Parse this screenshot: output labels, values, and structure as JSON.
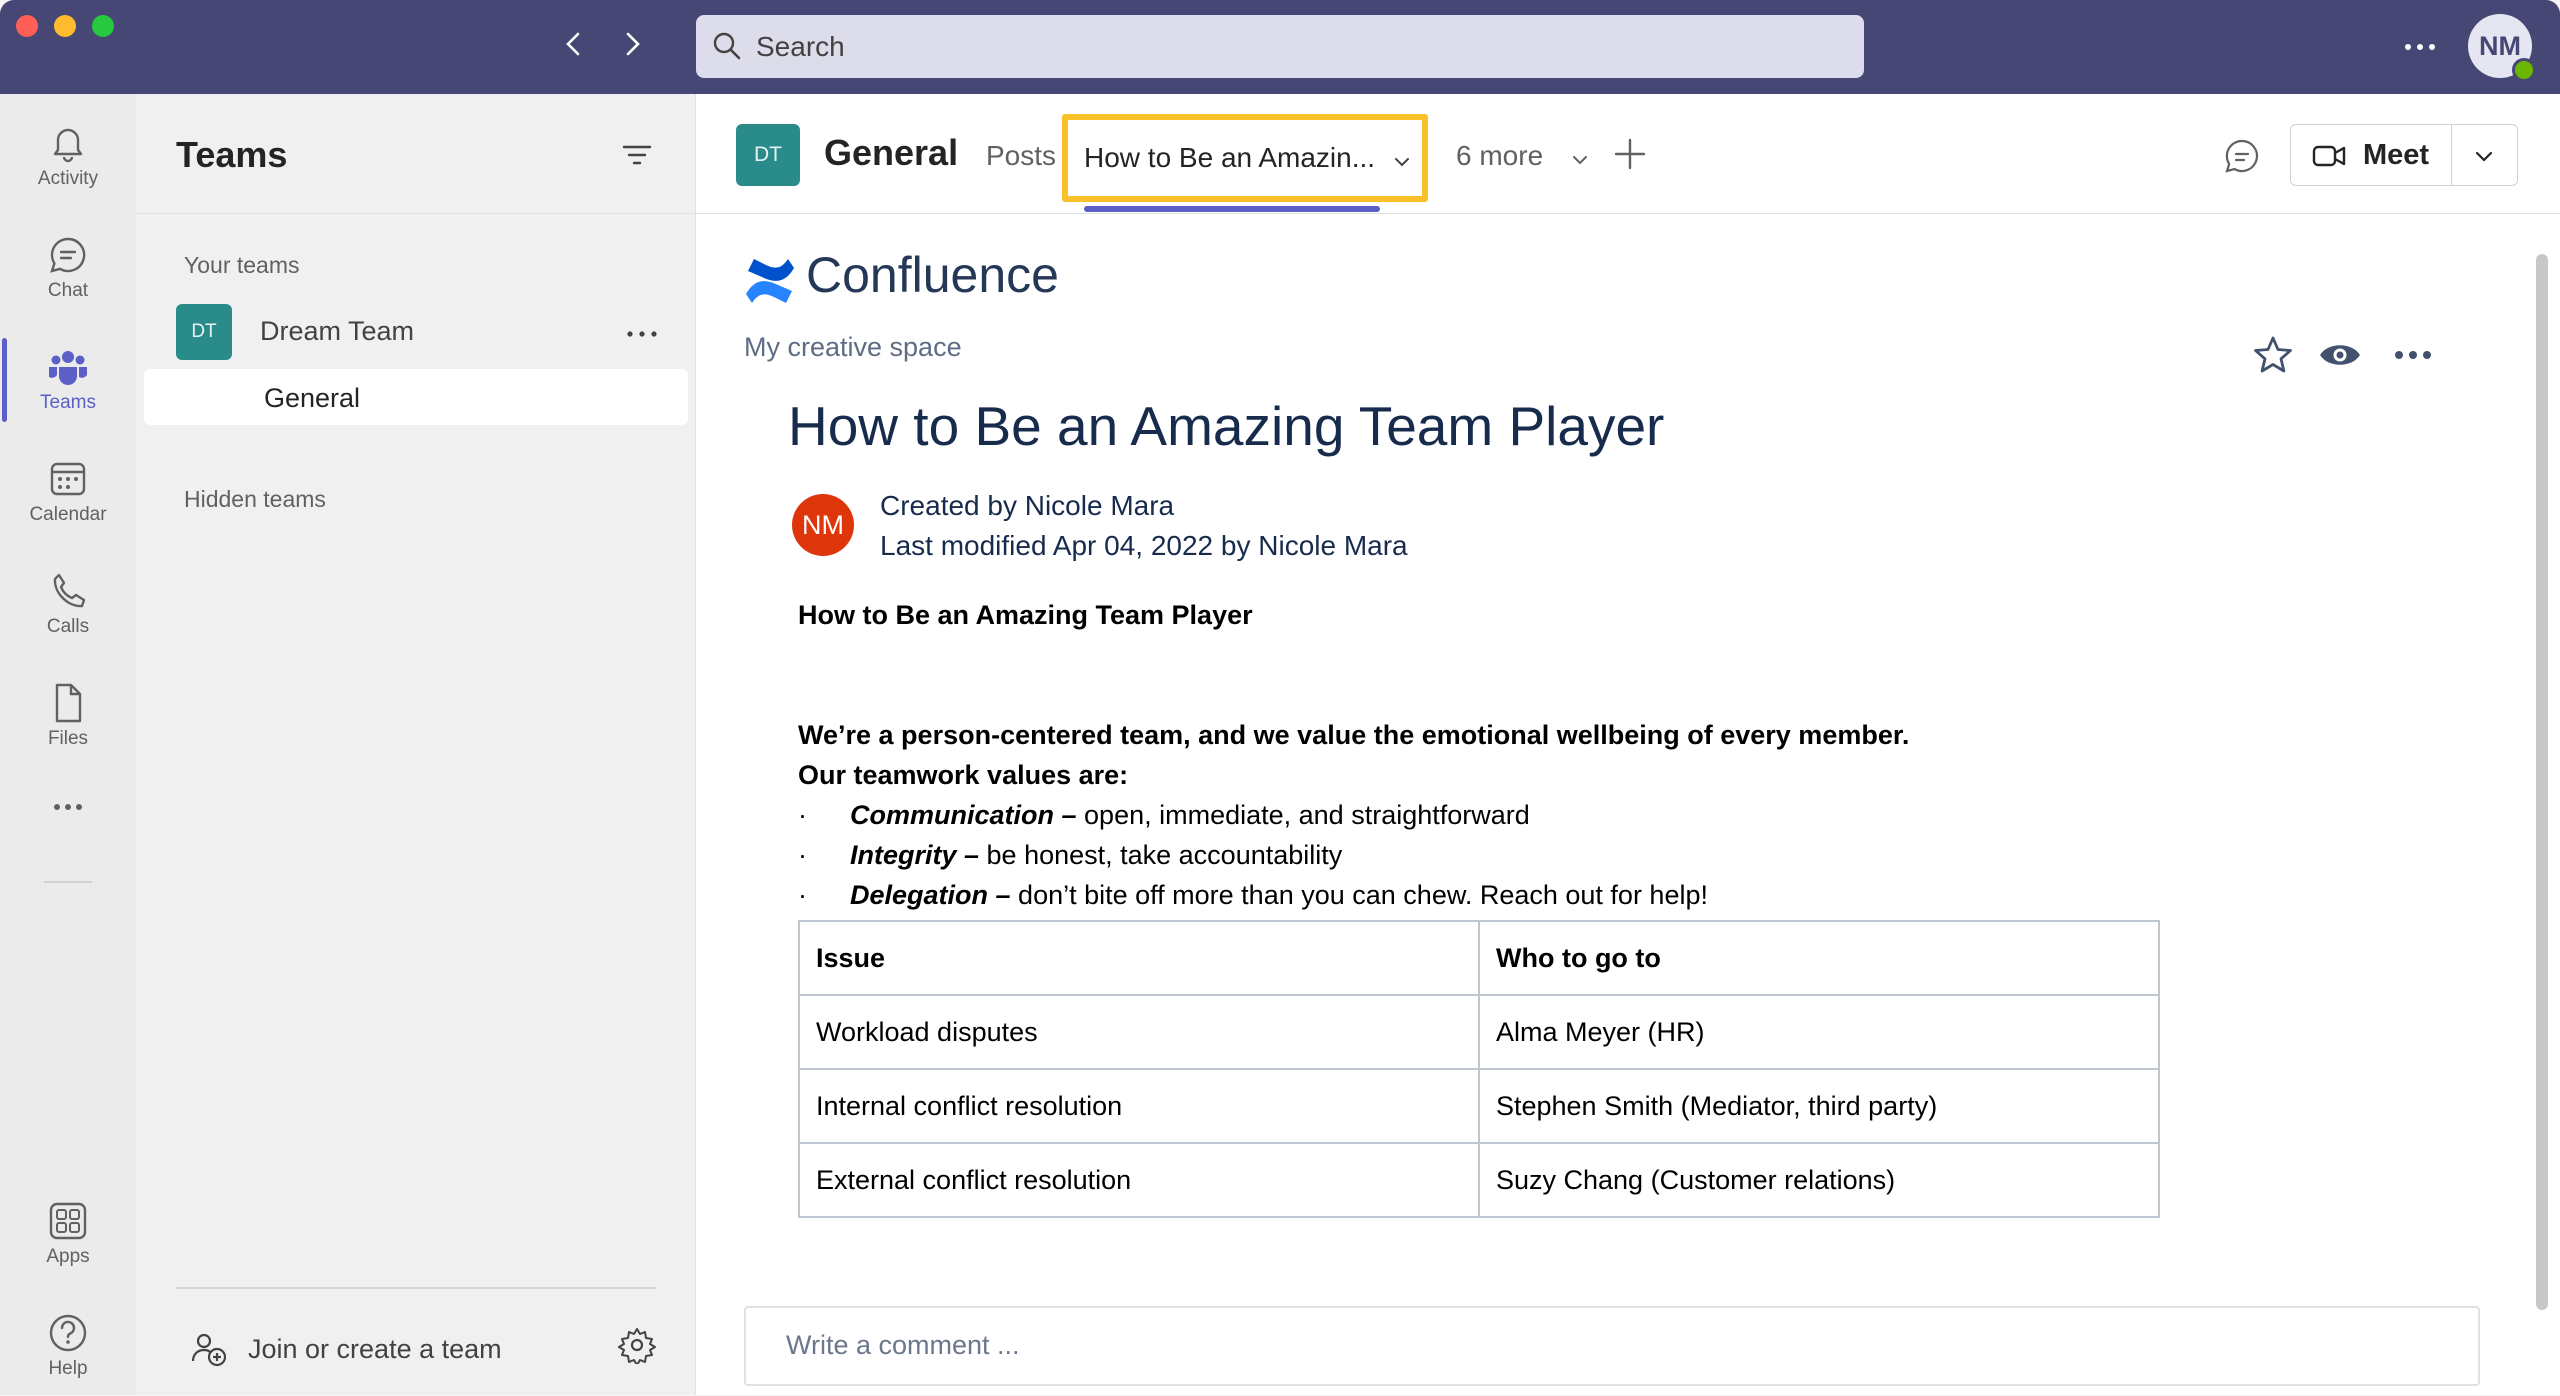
{
  "search": {
    "placeholder": "Search"
  },
  "user": {
    "initials": "NM"
  },
  "rail": {
    "items": [
      {
        "label": "Activity",
        "icon": "bell-icon"
      },
      {
        "label": "Chat",
        "icon": "chat-icon"
      },
      {
        "label": "Teams",
        "icon": "teams-icon",
        "active": true
      },
      {
        "label": "Calendar",
        "icon": "calendar-icon"
      },
      {
        "label": "Calls",
        "icon": "phone-icon"
      },
      {
        "label": "Files",
        "icon": "file-icon"
      }
    ],
    "apps_label": "Apps",
    "help_label": "Help"
  },
  "teams_pane": {
    "title": "Teams",
    "your_teams_label": "Your teams",
    "team": {
      "initials": "DT",
      "name": "Dream Team"
    },
    "channel": "General",
    "hidden_teams_label": "Hidden teams",
    "join_label": "Join or create a team"
  },
  "channel_header": {
    "initials": "DT",
    "name": "General",
    "tabs": {
      "posts": "Posts",
      "active": "How to Be an Amazin...",
      "more": "6 more"
    },
    "meet_label": "Meet"
  },
  "confluence": {
    "brand": "Confluence",
    "space": "My creative space",
    "page_title": "How to Be an Amazing Team Player",
    "author_initials": "NM",
    "created_by": "Created by Nicole Mara",
    "last_modified": "Last modified Apr 04, 2022 by Nicole Mara",
    "body_title": "How to Be an Amazing Team Player",
    "intro": "We’re a person-centered team, and we value the emotional wellbeing of every member.",
    "values_heading": "Our teamwork values are:",
    "values": [
      {
        "bullet": "·",
        "term": "Communication –",
        "desc": " open, immediate, and straightforward"
      },
      {
        "bullet": "·",
        "term": "Integrity –",
        "desc": " be honest, take accountability"
      },
      {
        "bullet": "·",
        "term": "Delegation –",
        "desc": " don’t bite off more than you can chew. Reach out for help!"
      }
    ],
    "table": {
      "headers": [
        "Issue",
        "Who to go to"
      ],
      "rows": [
        [
          "Workload disputes",
          "Alma Meyer (HR)"
        ],
        [
          "Internal conflict resolution",
          "Stephen Smith (Mediator, third party)"
        ],
        [
          "External conflict resolution",
          "Suzy Chang (Customer relations)"
        ]
      ]
    },
    "comment_placeholder": "Write a comment ..."
  },
  "colors": {
    "titlebar": "#464775",
    "accent": "#5b5fc7",
    "highlight": "#f9c02a",
    "team_logo": "#2a8b8b",
    "author_avatar": "#de350b",
    "presence": "#6bb700"
  }
}
